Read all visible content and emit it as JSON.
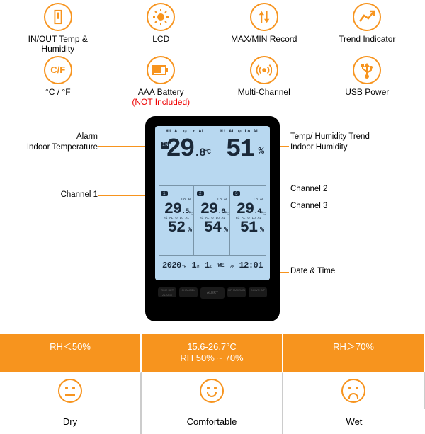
{
  "features": [
    {
      "icon": "thermo-icon",
      "label_l1": "IN/OUT Temp &",
      "label_l2": "Humidity"
    },
    {
      "icon": "sun-icon",
      "label_l1": "LCD",
      "label_l2": ""
    },
    {
      "icon": "updown-icon",
      "label_l1": "MAX/MIN Record",
      "label_l2": ""
    },
    {
      "icon": "trend-icon",
      "label_l1": "Trend Indicator",
      "label_l2": ""
    },
    {
      "icon": "cf-icon",
      "label_l1": "°C / °F",
      "label_l2": ""
    },
    {
      "icon": "battery-icon",
      "label_l1": "AAA Battery",
      "label_l2_red": "(NOT Included)"
    },
    {
      "icon": "signal-icon",
      "label_l1": "Multi-Channel",
      "label_l2": ""
    },
    {
      "icon": "usb-icon",
      "label_l1": "USB Power",
      "label_l2": ""
    }
  ],
  "callouts": {
    "alarm": "Alarm",
    "indoor_temp": "Indoor Temperature",
    "ch1": "Channel 1",
    "trend": "Temp/ Humidity Trend",
    "indoor_hum": "Indoor Humidity",
    "ch2": "Channel 2",
    "ch3": "Channel 3",
    "datetime": "Date & Time"
  },
  "display": {
    "hilo_label": "Hi AL ⊙ Lo AL",
    "in_tag": "IN",
    "main_temp": "29",
    "main_temp_dec": ".8",
    "main_temp_unit": "°C",
    "main_hum": "51",
    "main_hum_unit": "%",
    "channels": [
      {
        "tag": "1",
        "lo": "Lo AL",
        "temp": "29",
        "temp_dec": ".5",
        "hilo": "Hi AL ⊙ Lo AL",
        "hum": "52"
      },
      {
        "tag": "2",
        "lo": "Lo AL",
        "temp": "29",
        "temp_dec": ".6",
        "hilo": "Hi AL ⊙ Lo AL",
        "hum": "54"
      },
      {
        "tag": "3",
        "lo": "Lo AL",
        "temp": "29",
        "temp_dec": ".4",
        "hilo": "Hi AL ⊙ Lo AL",
        "hum": "51"
      }
    ],
    "date_year": "2020",
    "date_yr": "YR",
    "date_m": "1",
    "date_mu": "M",
    "date_d": "1",
    "date_du": "D",
    "date_wd": "WE",
    "date_am": "AM",
    "date_time": "12:01"
  },
  "buttons": {
    "b1": "TIME SET\nALARM",
    "b2": "CHANNEL",
    "b3": "ALERT",
    "b4": "UP\nMAX/MIN",
    "b5": "DOWN\nC/F"
  },
  "comfort": {
    "h1": "RH＜50%",
    "h2a": "15.6-26.7°C",
    "h2b": "RH 50% ~ 70%",
    "h3": "RH＞70%",
    "l1": "Dry",
    "l2": "Comfortable",
    "l3": "Wet"
  }
}
